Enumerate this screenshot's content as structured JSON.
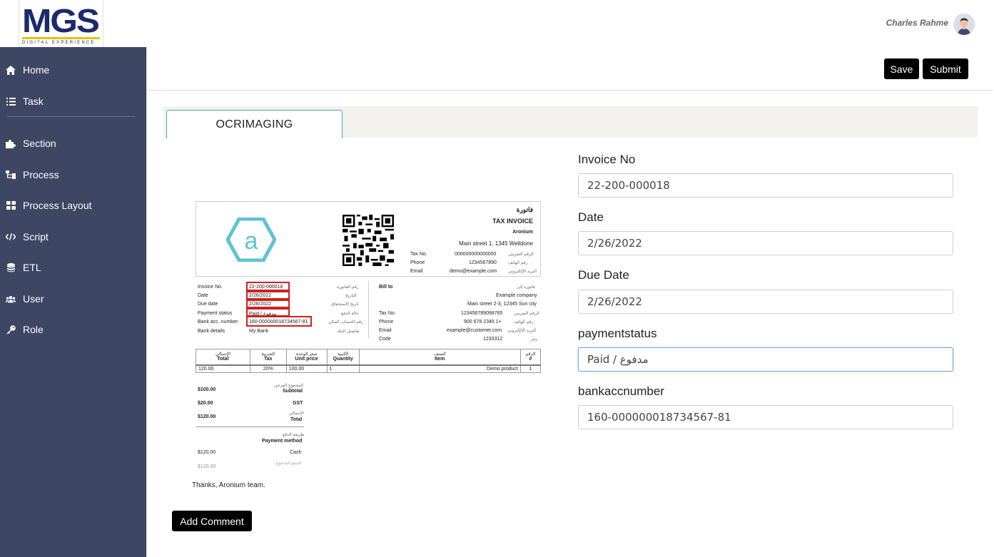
{
  "header": {
    "logo_text": "MGS",
    "logo_subtitle": "DIGITAL EXPERIENCE",
    "user_name": "Charles Rahme"
  },
  "sidebar": {
    "items": [
      {
        "label": "Home",
        "icon": "home-icon"
      },
      {
        "label": "Task",
        "icon": "list-icon"
      },
      {
        "label": "Section",
        "icon": "puzzle-icon"
      },
      {
        "label": "Process",
        "icon": "sitemap-icon"
      },
      {
        "label": "Process Layout",
        "icon": "grid-icon"
      },
      {
        "label": "Script",
        "icon": "code-icon"
      },
      {
        "label": "ETL",
        "icon": "database-icon"
      },
      {
        "label": "User",
        "icon": "users-icon"
      },
      {
        "label": "Role",
        "icon": "key-icon"
      }
    ]
  },
  "toolbar": {
    "save_label": "Save",
    "submit_label": "Submit"
  },
  "tabs": [
    {
      "label": "OCRIMAGING",
      "active": true
    }
  ],
  "invoice": {
    "title_ar": "فاتورة",
    "title": "TAX INVOICE",
    "company": "Aronium",
    "address": "Main street 1, 1345 Welldone",
    "seller": [
      {
        "label": "Tax No.",
        "value": "000000000000000",
        "ar": "الرقم الضريبي"
      },
      {
        "label": "Phone",
        "value": "1234567890",
        "ar": "رقم الهاتف"
      },
      {
        "label": "Email",
        "value": "demo@example.com",
        "ar": "البريد الإلكتروني"
      }
    ],
    "details": [
      {
        "label": "Invoice No",
        "value": "22-200-000018",
        "ar": "رقم الفاتورة"
      },
      {
        "label": "Date",
        "value": "2/26/2022",
        "ar": "التاريخ"
      },
      {
        "label": "Due date",
        "value": "2/26/2022",
        "ar": "تاريخ الاستحقاق"
      },
      {
        "label": "Payment status",
        "value": "Paid / مدفوع",
        "ar": "حالة الدفع"
      },
      {
        "label": "Bank acc. number",
        "value": "160-000000018734567-81",
        "ar": "رقم الحساب البنكي"
      },
      {
        "label": "Bank details",
        "value": "My Bank",
        "ar": "تفاصيل البنك"
      }
    ],
    "bill_to_label": "Bill to",
    "bill_to_ar": "فاتورة إلى",
    "bill_to": [
      {
        "label": "",
        "value": "Example company",
        "ar": ""
      },
      {
        "label": "",
        "value": "Main street 2-3, 12345 Sun city",
        "ar": ""
      },
      {
        "label": "Tax No.",
        "value": "123456789098765",
        "ar": "الرقم الضريبي"
      },
      {
        "label": "Phone",
        "value": "900 678 2345 1+",
        "ar": "رقم الهاتف"
      },
      {
        "label": "Email",
        "value": "example@customer.com",
        "ar": "البريد الإلكتروني"
      },
      {
        "label": "Code",
        "value": "1233312",
        "ar": "رمز"
      }
    ],
    "table_headers": [
      {
        "ar": "الإجمالي",
        "en": "Total"
      },
      {
        "ar": "الضريبة",
        "en": "Tax"
      },
      {
        "ar": "سعر الوحدة",
        "en": "Unit price"
      },
      {
        "ar": "الكمية",
        "en": "Quantity"
      },
      {
        "ar": "الصنف",
        "en": "Item"
      },
      {
        "ar": "الرقم",
        "en": "#"
      }
    ],
    "table_row": [
      "120.00",
      "20%",
      "100.00",
      "1",
      "Demo product",
      "1"
    ],
    "totals": [
      {
        "value": "$100.00",
        "ar": "المجموع الفرعي",
        "en": "Subtotal"
      },
      {
        "value": "$20.00",
        "ar": "",
        "en": "GST"
      },
      {
        "value": "$120.00",
        "ar": "الإجمالي",
        "en": "Total"
      }
    ],
    "payment_method_ar": "طريقة الدفع",
    "payment_method_label": "Payment method",
    "payment_rows": [
      {
        "value": "$120.00",
        "label": "Cash"
      },
      {
        "value": "$120.00",
        "label": "المبلغ المدفوع"
      }
    ],
    "thanks": "Thanks, Aronium team."
  },
  "comment_button_label": "Add Comment",
  "form": {
    "fields": [
      {
        "label": "Invoice No",
        "value": "22-200-000018"
      },
      {
        "label": "Date",
        "value": "2/26/2022"
      },
      {
        "label": "Due Date",
        "value": "2/26/2022"
      },
      {
        "label": "paymentstatus",
        "value": "Paid / مدفوع"
      },
      {
        "label": "bankaccnumber",
        "value": "160-000000018734567-81"
      }
    ]
  },
  "colors": {
    "sidebar_bg": "#3d4663",
    "logo_blue": "#1b2a6b",
    "logo_accent": "#e6c200",
    "tab_border": "#49a7c3",
    "highlight_red": "#d21e1e",
    "button_bg": "#000000"
  }
}
